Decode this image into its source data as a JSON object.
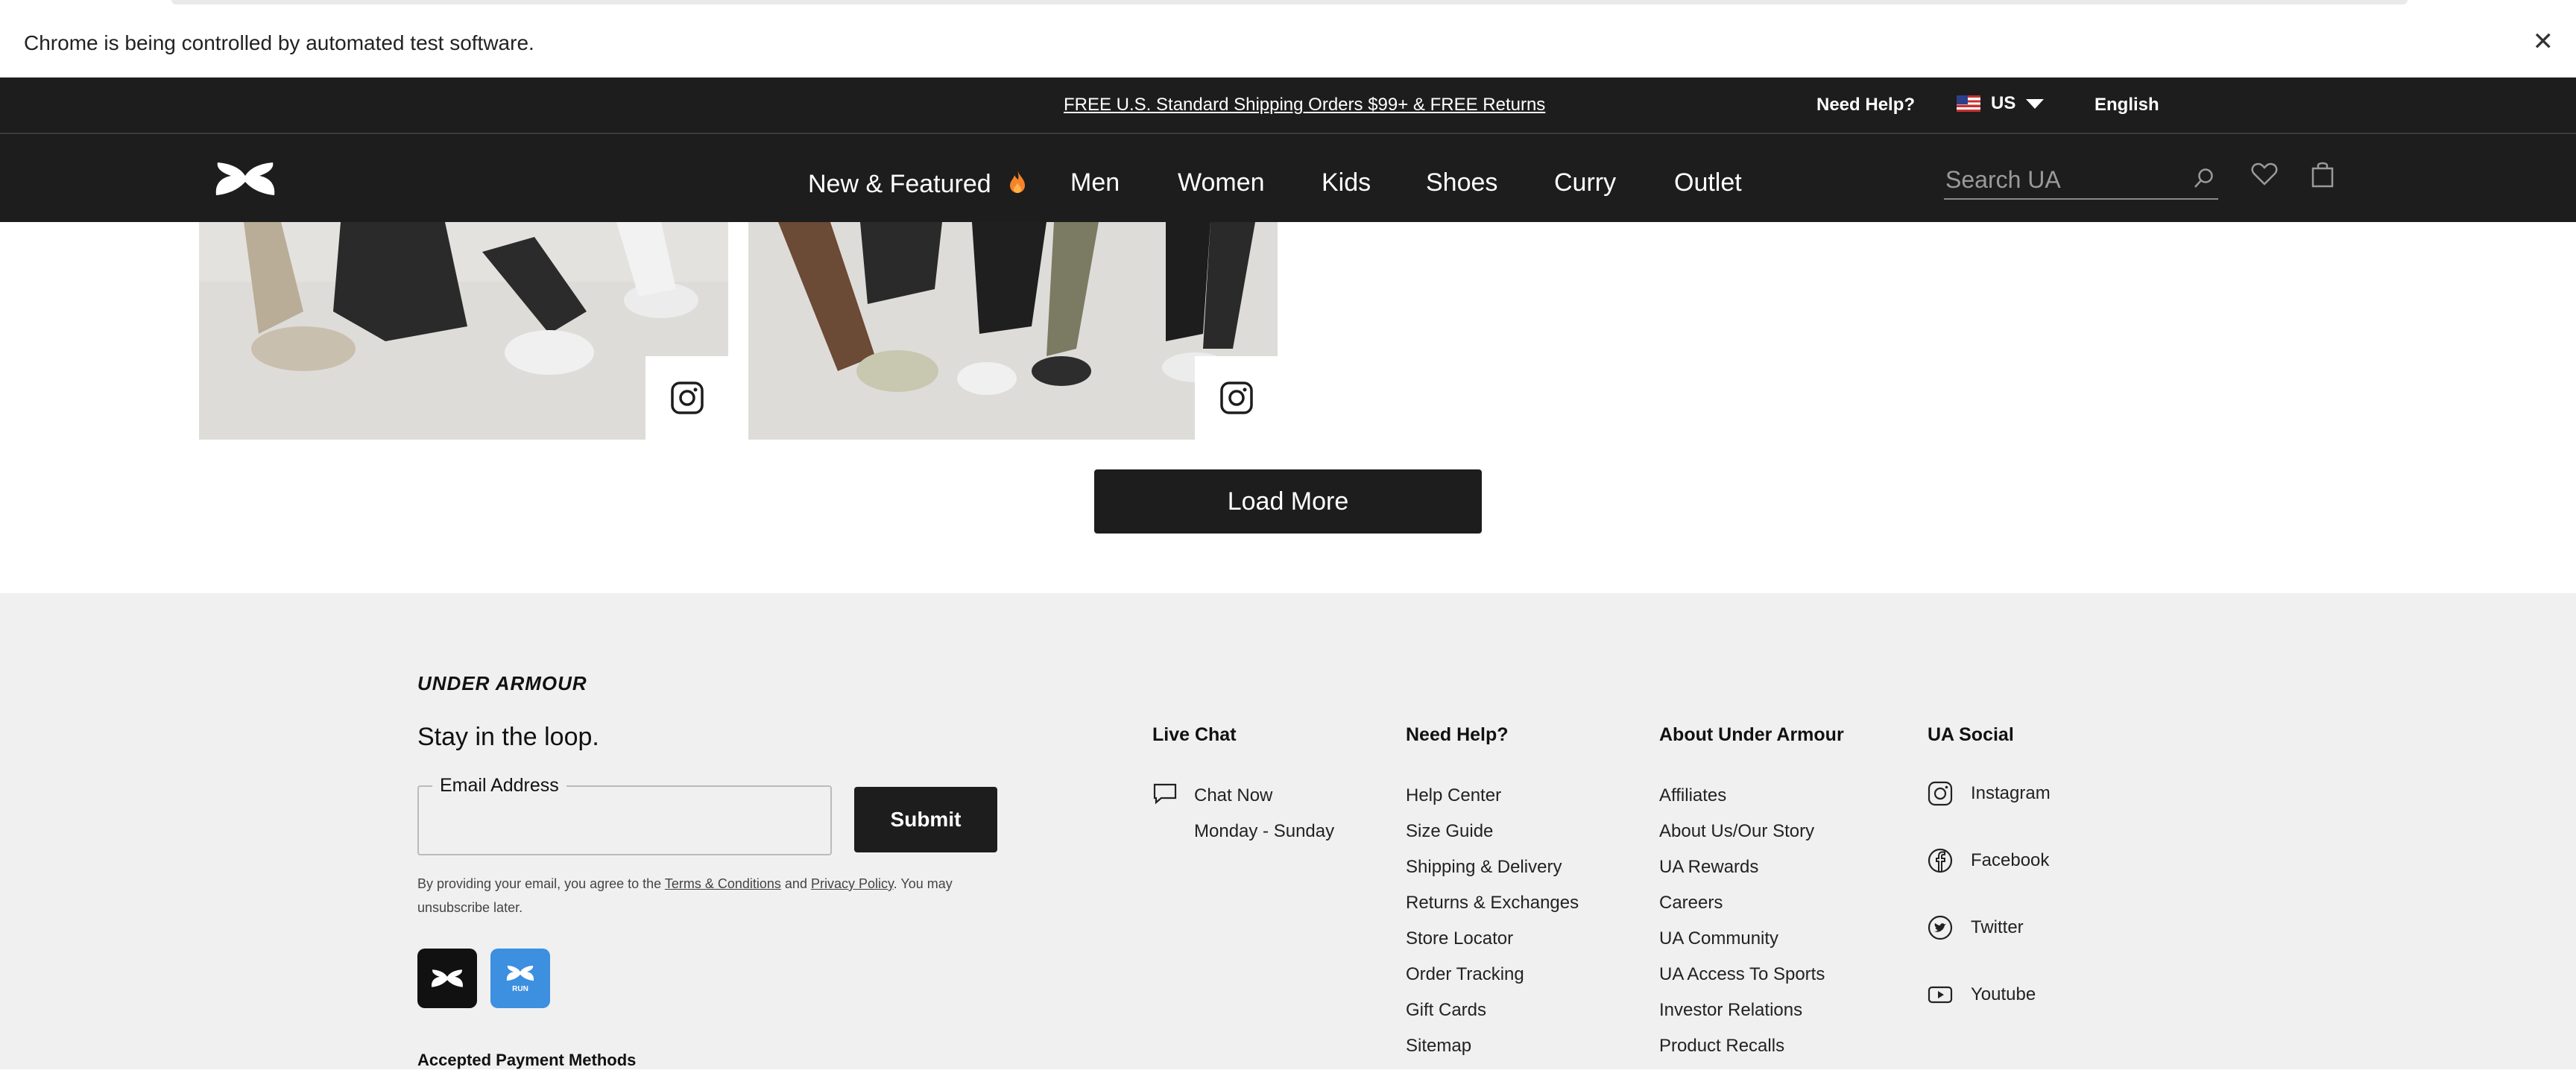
{
  "chrome": {
    "automation_message": "Chrome is being controlled by automated test software.",
    "close_glyph": "✕"
  },
  "promo": {
    "shipping_link": "FREE U.S. Standard Shipping Orders $99+ & FREE Returns",
    "need_help": "Need Help?",
    "country": "US",
    "language": "English"
  },
  "nav": {
    "items": [
      "New & Featured",
      "Men",
      "Women",
      "Kids",
      "Shoes",
      "Curry",
      "Outlet"
    ],
    "featured_icon": "flame-icon",
    "search_placeholder": "Search UA"
  },
  "gallery": {
    "load_more": "Load More"
  },
  "footer": {
    "brand": "UNDER ARMOUR",
    "tagline": "Stay in the loop.",
    "email_label": "Email Address",
    "submit": "Submit",
    "fine_print_1": "By providing your email, you agree to the ",
    "terms_link": "Terms & Conditions",
    "fine_and": " and ",
    "privacy_link": "Privacy Policy",
    "fine_print_2": ". You may unsubscribe later.",
    "app_run_label": "RUN",
    "payment_heading": "Accepted Payment Methods",
    "live_chat": {
      "heading": "Live Chat",
      "chat_now": "Chat Now",
      "hours": "Monday - Sunday"
    },
    "need_help": {
      "heading": "Need Help?",
      "links": [
        "Help Center",
        "Size Guide",
        "Shipping & Delivery",
        "Returns & Exchanges",
        "Store Locator",
        "Order Tracking",
        "Gift Cards",
        "Sitemap"
      ]
    },
    "about": {
      "heading": "About Under Armour",
      "links": [
        "Affiliates",
        "About Us/Our Story",
        "UA Rewards",
        "Careers",
        "UA Community",
        "UA Access To Sports",
        "Investor Relations",
        "Product Recalls"
      ]
    },
    "social": {
      "heading": "UA Social",
      "links": [
        "Instagram",
        "Facebook",
        "Twitter",
        "Youtube"
      ]
    }
  },
  "colors": {
    "dark": "#1d1d1d",
    "footer_bg": "#f0f0f0",
    "run_app_blue": "#3d8fe0",
    "flame": "#f5832a"
  }
}
